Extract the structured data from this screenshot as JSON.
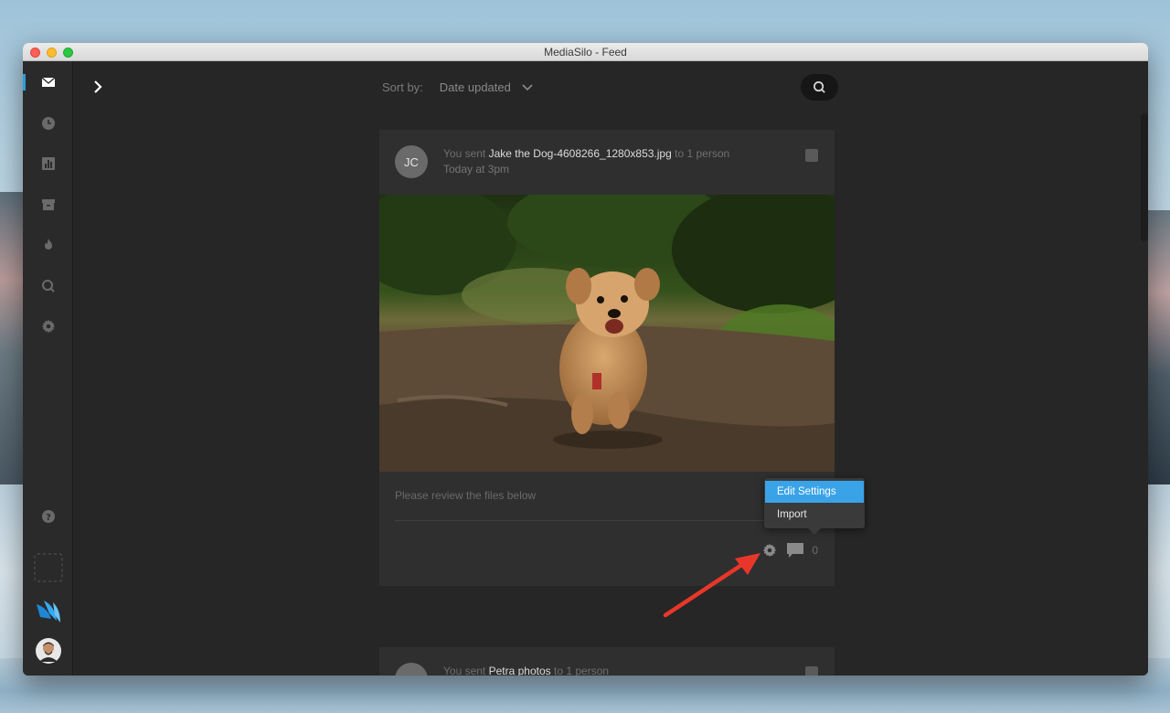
{
  "window": {
    "title": "MediaSilo - Feed"
  },
  "sidebar": {
    "items": [
      {
        "icon": "inbox-icon",
        "active": true
      },
      {
        "icon": "clock-icon",
        "active": false
      },
      {
        "icon": "bar-chart-icon",
        "active": false
      },
      {
        "icon": "archive-icon",
        "active": false
      },
      {
        "icon": "flame-icon",
        "active": false
      },
      {
        "icon": "search-icon",
        "active": false
      },
      {
        "icon": "gear-icon",
        "active": false
      }
    ],
    "bottom": [
      {
        "icon": "help-icon"
      },
      {
        "icon": "dropzone-icon"
      },
      {
        "icon": "mediasilo-logo"
      },
      {
        "icon": "user-avatar"
      }
    ]
  },
  "toolbar": {
    "sort_label": "Sort by:",
    "sort_value": "Date updated"
  },
  "feed": {
    "posts": [
      {
        "initials": "JC",
        "prefix": "You sent",
        "filename": "Jake the Dog-4608266_1280x853.jpg",
        "suffix": "to 1 person",
        "time": "Today at 3pm",
        "message": "Please review the files below",
        "comment_count": "0"
      },
      {
        "prefix": "You sent",
        "filename": "Petra photos",
        "suffix": "to 1 person"
      }
    ]
  },
  "dropdown": {
    "items": [
      {
        "label": "Edit Settings",
        "selected": true
      },
      {
        "label": "Import",
        "selected": false
      }
    ]
  },
  "colors": {
    "accent": "#3aa3e8",
    "active_indicator": "#2d9cdb",
    "annotation_arrow": "#e8372a",
    "background": "#262626",
    "card": "#2f2f2f"
  }
}
